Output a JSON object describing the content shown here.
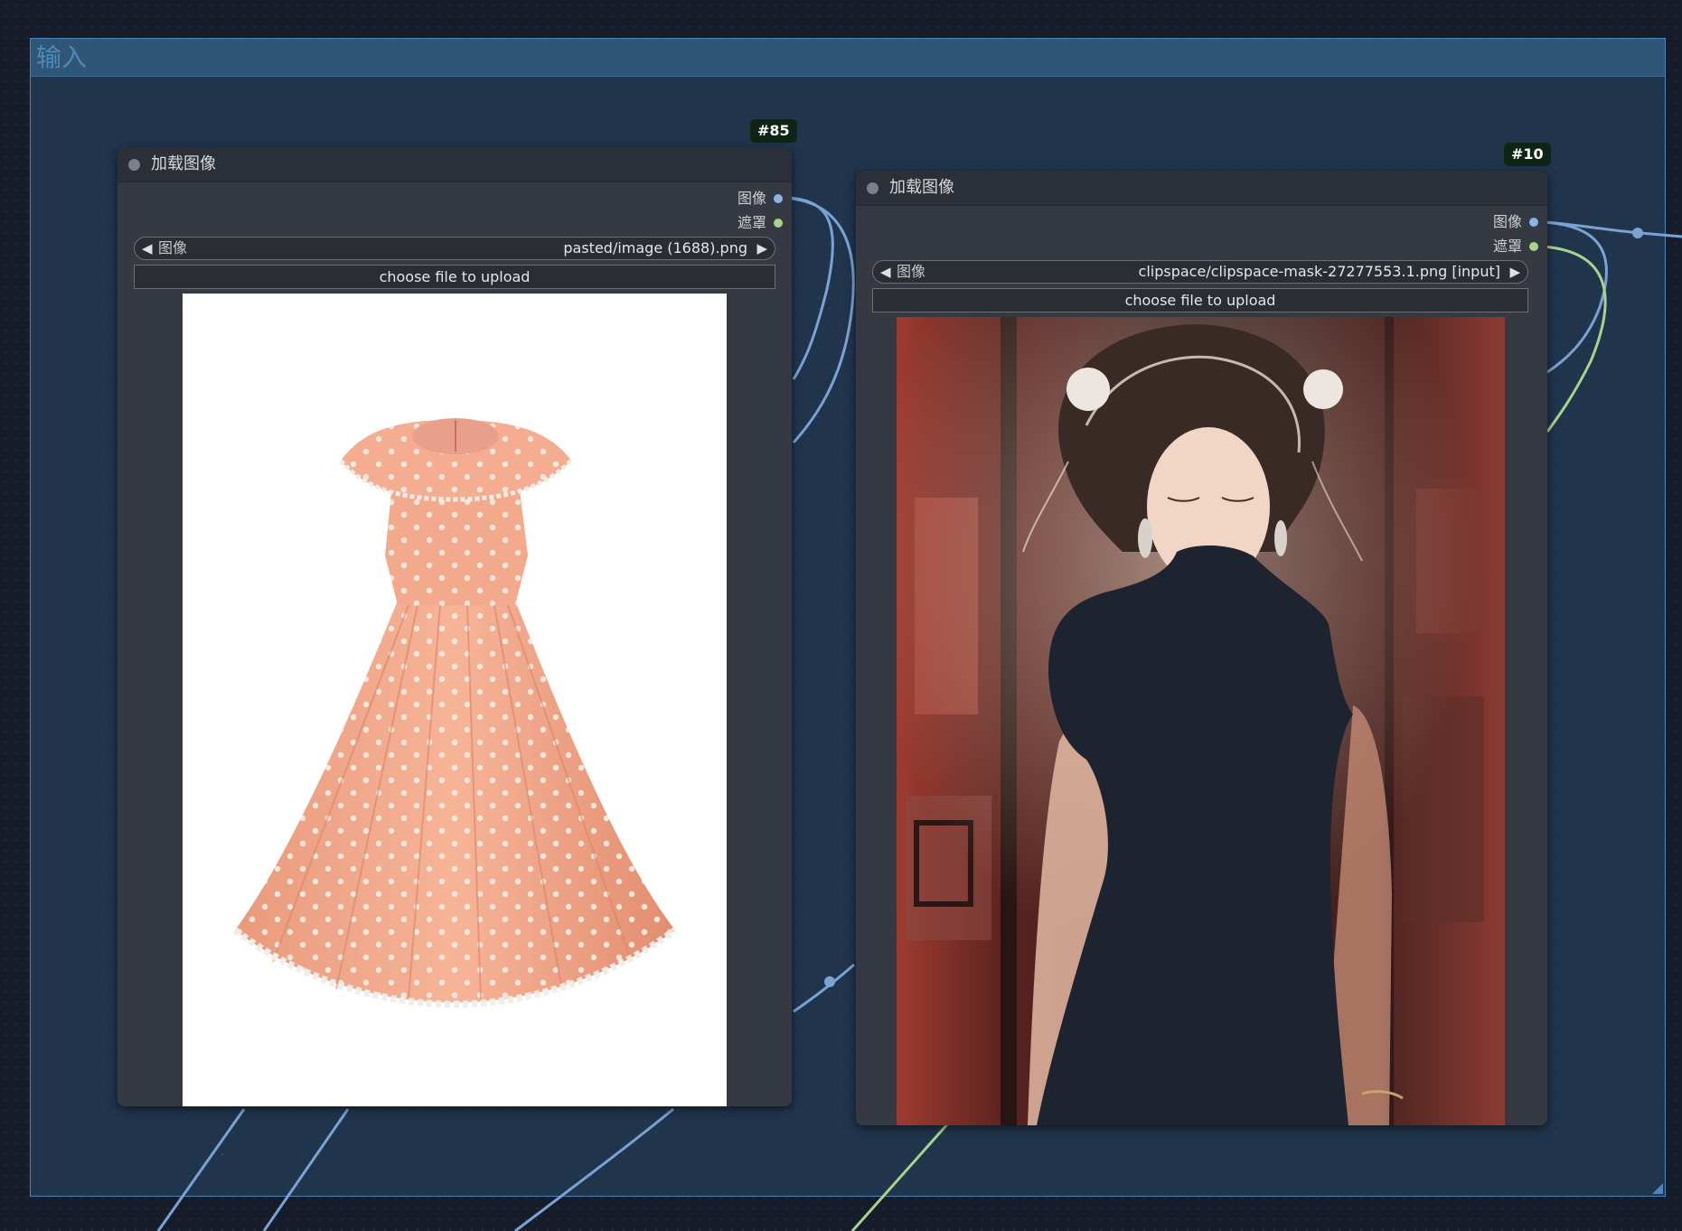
{
  "group": {
    "title": "输入"
  },
  "nodes": [
    {
      "id_badge": "#85",
      "title": "加载图像",
      "outputs": [
        {
          "label": "图像",
          "color": "#8ab4e8"
        },
        {
          "label": "遮罩",
          "color": "#a9d38c"
        }
      ],
      "image_widget": {
        "label": "图像",
        "value": "pasted/image (1688).png"
      },
      "upload_label": "choose file to upload",
      "preview": "peach-polka-dot-dress"
    },
    {
      "id_badge": "#10",
      "title": "加载图像",
      "outputs": [
        {
          "label": "图像",
          "color": "#8ab4e8"
        },
        {
          "label": "遮罩",
          "color": "#a9d38c"
        }
      ],
      "image_widget": {
        "label": "图像",
        "value": "clipspace/clipspace-mask-27277553.1.png [input]"
      },
      "upload_label": "choose file to upload",
      "preview": "girl-with-masked-dress"
    }
  ],
  "wire_colors": {
    "image": "#7aa3d3",
    "mask": "#a9d38c"
  }
}
